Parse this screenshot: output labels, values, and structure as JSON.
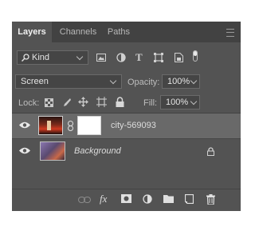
{
  "tabs": [
    {
      "label": "Layers",
      "active": true
    },
    {
      "label": "Channels",
      "active": false
    },
    {
      "label": "Paths",
      "active": false
    }
  ],
  "filter": {
    "kind_label": "Kind",
    "icons": [
      "search-icon",
      "image-filter-icon",
      "adjustment-filter-icon",
      "type-filter-icon",
      "shape-filter-icon",
      "smart-object-filter-icon",
      "filter-toggle"
    ]
  },
  "blend": {
    "mode": "Screen",
    "opacity_label": "Opacity:",
    "opacity_value": "100%"
  },
  "lock": {
    "label": "Lock:",
    "fill_label": "Fill:",
    "fill_value": "100%"
  },
  "layers": [
    {
      "name": "city-569093",
      "selected": true,
      "has_mask": true,
      "italic": false,
      "locked": false
    },
    {
      "name": "Background",
      "selected": false,
      "has_mask": false,
      "italic": true,
      "locked": true
    }
  ],
  "bottom_icons": [
    "link-layers-icon",
    "fx-icon",
    "add-mask-icon",
    "new-adjustment-icon",
    "new-group-icon",
    "new-layer-icon",
    "delete-icon"
  ],
  "colors": {
    "panel_bg": "#535353",
    "tabbar_bg": "#424242",
    "selected_row": "#696969",
    "text": "#d6d6d6"
  }
}
